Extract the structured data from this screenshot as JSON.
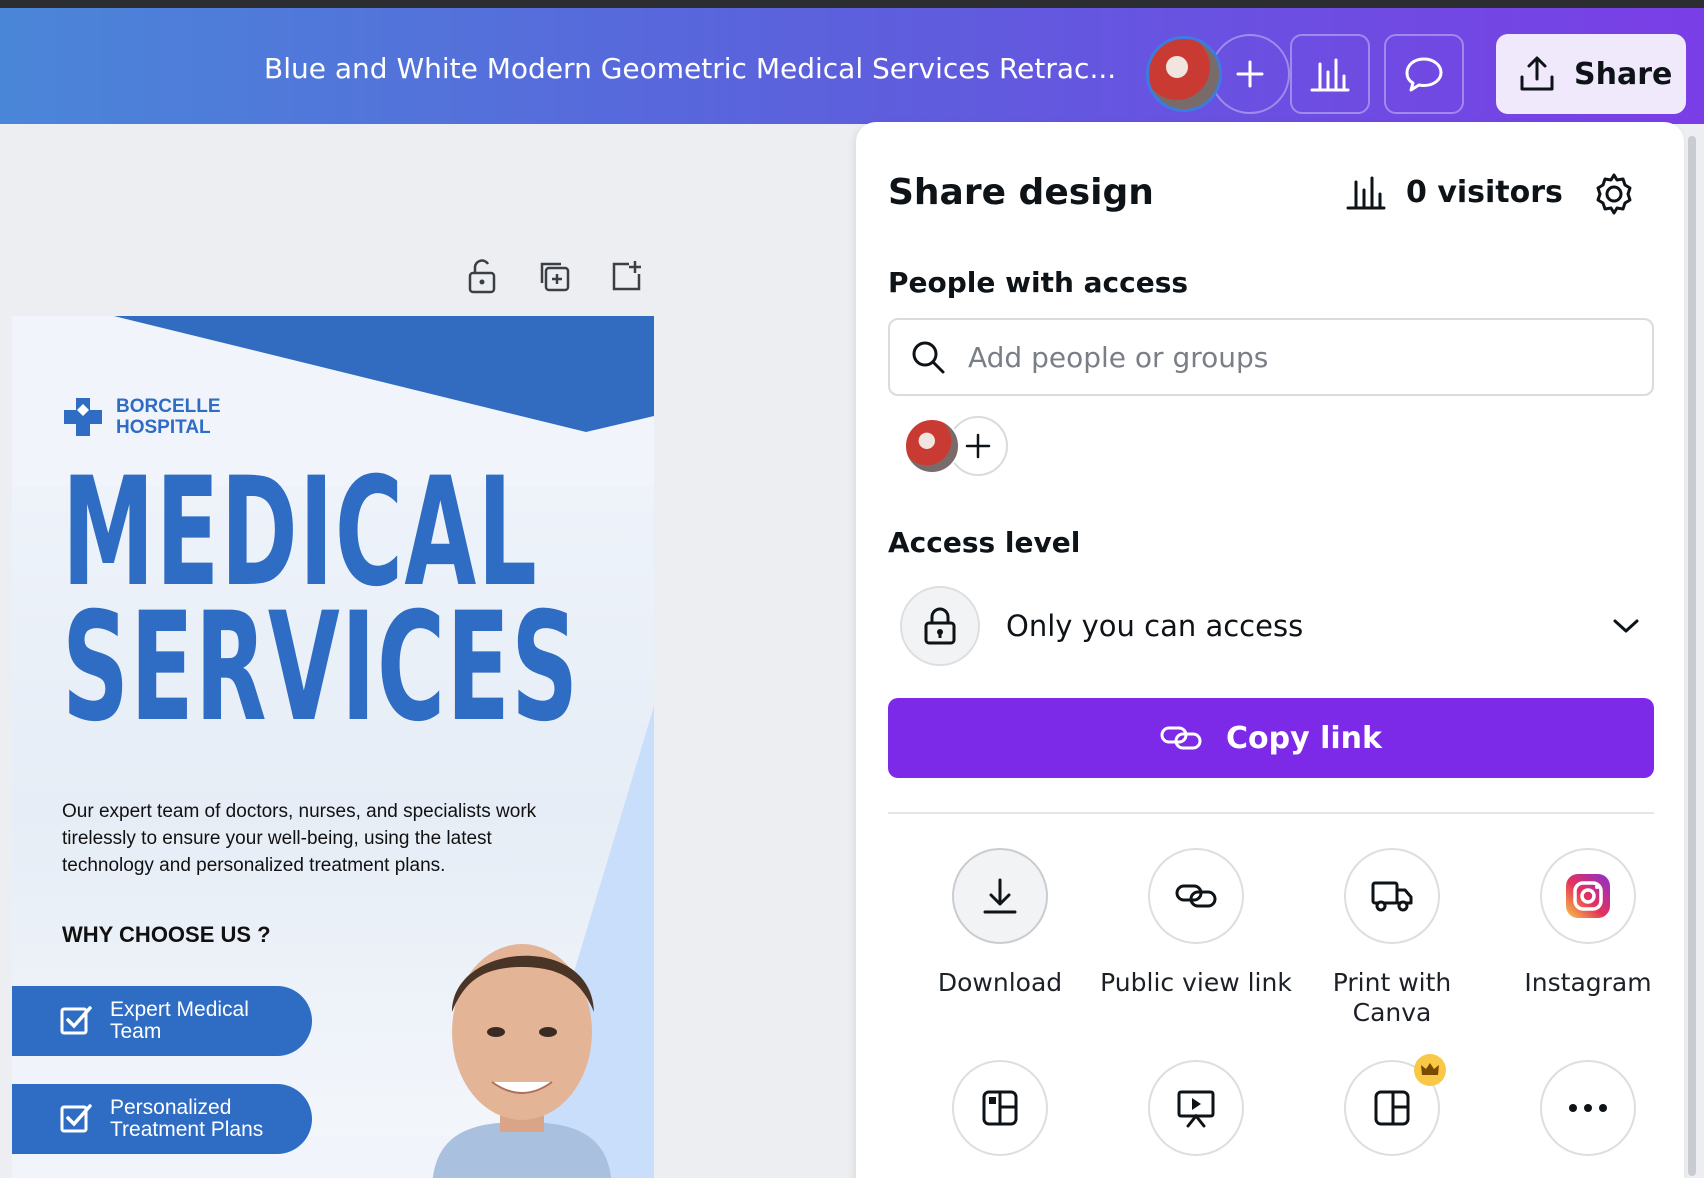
{
  "topbar": {
    "document_title": "Blue and White Modern Geometric Medical Services Retrac...",
    "share_label": "Share",
    "icons": [
      "plus-icon",
      "analytics-icon",
      "comment-icon",
      "share-upload-icon"
    ]
  },
  "design": {
    "logo_line1": "BORCELLE",
    "logo_line2": "HOSPITAL",
    "headline_line1": "MEDICAL",
    "headline_line2": "SERVICES",
    "body_copy": "Our expert team of doctors, nurses, and specialists work tirelessly to ensure your well-being, using the latest technology and personalized treatment plans.",
    "why_heading": "WHY CHOOSE US ?",
    "pills": [
      {
        "label": "Expert Medical Team"
      },
      {
        "label": "Personalized Treatment Plans"
      }
    ]
  },
  "share_panel": {
    "title": "Share design",
    "visitors": "0 visitors",
    "people_heading": "People with access",
    "search_placeholder": "Add people or groups",
    "access_heading": "Access level",
    "access_value": "Only you can access",
    "copy_link": "Copy link",
    "options": [
      {
        "label": "Download",
        "icon": "download-icon"
      },
      {
        "label": "Public view link",
        "icon": "link-icon"
      },
      {
        "label": "Print with Canva",
        "icon": "truck-icon"
      },
      {
        "label": "Instagram",
        "icon": "instagram-icon"
      }
    ],
    "more_options": [
      {
        "icon": "layout-icon"
      },
      {
        "icon": "presentation-icon"
      },
      {
        "icon": "premium-layout-icon"
      },
      {
        "icon": "more-icon"
      }
    ]
  },
  "colors": {
    "brand_purple": "#7d2ae8",
    "design_blue": "#2f6cc4"
  }
}
